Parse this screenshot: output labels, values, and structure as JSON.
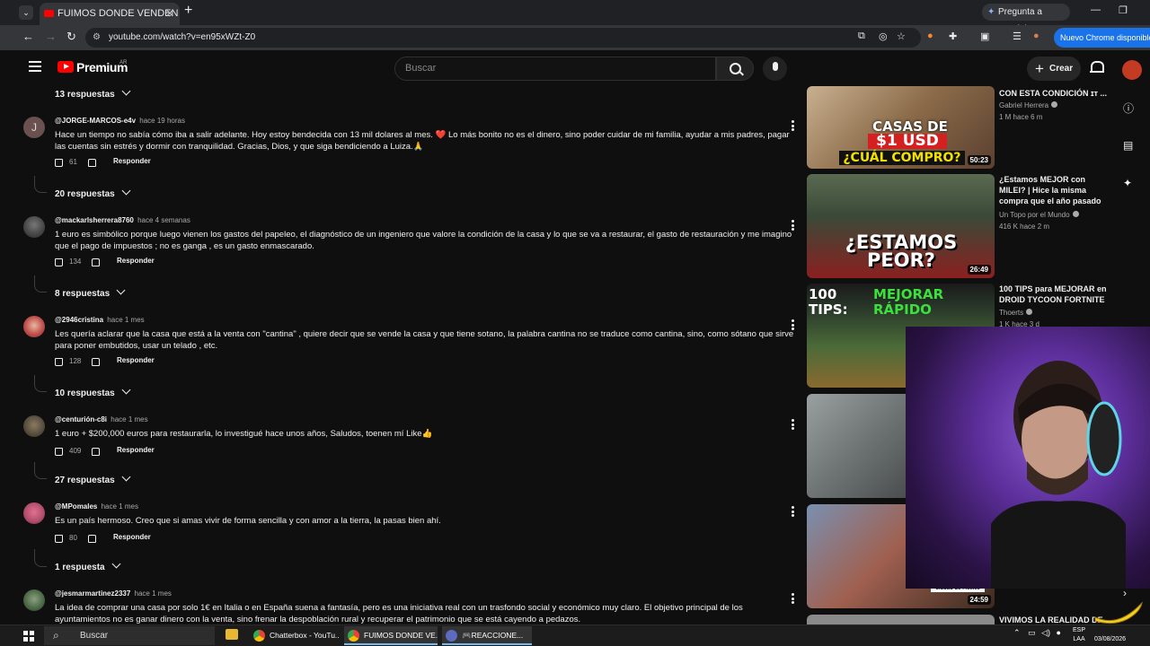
{
  "browser": {
    "tab_title": "FUIMOS DONDE VENDEN CASA",
    "tab_close": "✕",
    "new_tab": "+",
    "gemini_label": "Pregunta a Gemini",
    "url": "youtube.com/watch?v=en95xWZt-Z0",
    "update_label": "Nuevo Chrome disponible",
    "window_minimize": "—",
    "window_restore": "❐"
  },
  "youtube": {
    "brand": "Premium",
    "country": "AR",
    "search_placeholder": "Buscar",
    "create_label": "Crear"
  },
  "comments": {
    "reply_toggles": [
      "13 respuestas",
      "20 respuestas",
      "8 respuestas",
      "10 respuestas",
      "27 respuestas",
      "1 respuesta"
    ],
    "items": [
      {
        "author": "@JORGE-MARCOS-e4v",
        "time": "hace 19 horas",
        "text": "Hace un tiempo no sabía cómo iba a salir adelante. Hoy estoy bendecida con 13 mil dolares al mes. ❤️ Lo más bonito no es el dinero, sino poder cuidar de mi familia, ayudar a mis padres, pagar las cuentas sin estrés y dormir con tranquilidad. Gracias, Dios, y que siga bendiciendo a Luiza.🙏",
        "likes": "61",
        "reply": "Responder",
        "avatar_letter": "J",
        "avatar_color": "#6b5050"
      },
      {
        "author": "@mackarlsherrera8760",
        "time": "hace 4 semanas",
        "text": "1 euro es simbólico porque luego vienen los gastos del papeleo, el diagnóstico de un ingeniero que valore la condición de la casa y lo que se va a restaurar, el gasto de restauración y me imagino que el pago de impuestos ; no es ganga , es un gasto enmascarado.",
        "likes": "134",
        "reply": "Responder",
        "avatar_color": "#4a4a4a"
      },
      {
        "author": "@2946cristina",
        "time": "hace 1 mes",
        "text": "Les quería aclarar que la casa que está a la venta con \"cantina\" , quiere decir que se vende la casa y que tiene sotano, la palabra cantina no se traduce como cantina, sino, como sótano que sirve para poner embutidos, usar un telado , etc.",
        "likes": "128",
        "reply": "Responder",
        "avatar_color": "#c0504d"
      },
      {
        "author": "@centurión-c8i",
        "time": "hace 1 mes",
        "text": "1 euro + $200,000 euros para restaurarla, lo investigué hace unos años, Saludos, toenen mí Like👍",
        "likes": "409",
        "reply": "Responder",
        "avatar_color": "#5a5040"
      },
      {
        "author": "@MPomales",
        "time": "hace 1 mes",
        "text": "Es un país hermoso. Creo que si amas vivir de forma sencilla y con amor a la tierra, la pasas bien  ahí.",
        "likes": "80",
        "reply": "Responder",
        "avatar_color": "#b4506e"
      },
      {
        "author": "@jesmarmartinez2337",
        "time": "hace 1 mes",
        "text": "La idea de comprar una casa por solo 1€ en Italia o en España suena a fantasía, pero es una iniciativa real con un trasfondo social y económico muy claro. El objetivo principal de los ayuntamientos no es ganar dinero con la venta, sino frenar la despoblación rural y recuperar el patrimonio que se está cayendo a pedazos.",
        "avatar_color": "#4f6b4a"
      }
    ]
  },
  "sidebar": {
    "videos": [
      {
        "title": "CON ESTA CONDICIÓN ɪᴛ ...",
        "channel": "Gabriel Herrera",
        "meta": "1 M  hace 6 m",
        "duration": "50:23",
        "thumb_lines": [
          "CASAS DE",
          "$1 USD",
          "¿CUÁL COMPRO?"
        ]
      },
      {
        "title": "¿Estamos MEJOR con MILEI? | Hice la misma compra que el año pasado",
        "channel": "Un Topo por el Mundo",
        "meta": "416 K  hace 2 m",
        "duration": "26:49",
        "thumb_lines": [
          "¿ESTAMOS",
          "PEOR?"
        ]
      },
      {
        "title": "100 TIPS para MEJORAR en DROID TYCOON FORTNITE",
        "channel": "Thoerts",
        "meta": "1 K  hace 3 d",
        "duration": "",
        "thumb_lines": [
          "100 TIPS:",
          "MEJORAR RÁPIDO"
        ]
      },
      {
        "title": "",
        "channel": "",
        "meta": "",
        "duration": "",
        "thumb_lines": []
      },
      {
        "title": "",
        "channel": "",
        "meta": "",
        "duration": "24:59",
        "thumb_lines": [
          "Ciudad de México"
        ]
      },
      {
        "title": "VIVIMOS LA REALIDAD DE",
        "channel": "",
        "meta": "",
        "duration": "",
        "thumb_lines": []
      }
    ]
  },
  "taskbar": {
    "search_label": "Buscar",
    "apps": [
      "Chatterbox - YouTu...",
      "FUIMOS DONDE VE...",
      "🎮REACCIONE..."
    ],
    "lang_top": "ESP",
    "lang_bottom": "LAA",
    "date": "03/08/2026"
  },
  "colors": {
    "youtube_red": "#ff0000",
    "chrome_blue": "#1a73e8",
    "background": "#0f0f0f"
  }
}
